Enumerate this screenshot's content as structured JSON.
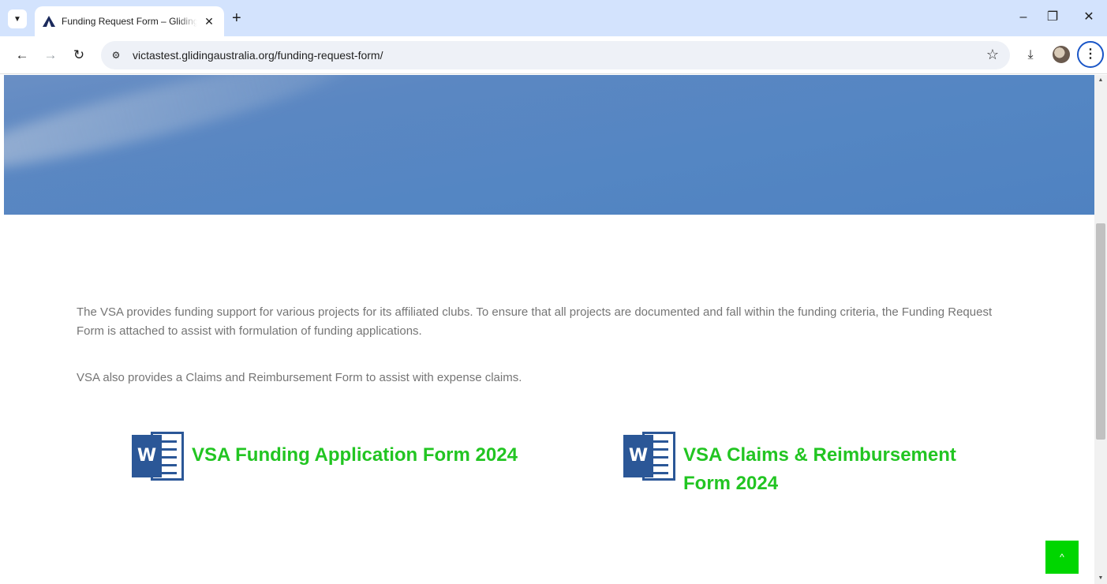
{
  "browser": {
    "tab_title": "Funding Request Form – Gliding Australia",
    "url": "victastest.glidingaustralia.org/funding-request-form/",
    "icons": {
      "tab_search": "chevron-down-icon",
      "favicon": "gliding-australia-logo",
      "tab_close": "close-icon",
      "new_tab": "plus-icon",
      "minimize": "minimize-icon",
      "restore": "restore-icon",
      "close_window": "close-icon",
      "back": "arrow-left-icon",
      "forward": "arrow-right-icon",
      "reload": "reload-icon",
      "site_info": "tune-icon",
      "bookmark": "star-icon",
      "downloads": "download-icon",
      "profile": "avatar",
      "menu": "kebab-menu-icon"
    }
  },
  "page": {
    "intro_text": "The VSA provides funding support for various projects for its affiliated clubs. To ensure that all projects are documented and fall within the funding criteria, the Funding Request Form is attached to assist with formulation of funding applications.",
    "intro_text_2": "VSA also provides a Claims and Reimbursement Form to assist with expense claims.",
    "documents": [
      {
        "label": "VSA Funding Application Form 2024",
        "icon": "word-document-icon",
        "icon_letter": "W"
      },
      {
        "label": "VSA Claims & Reimbursement Form 2024",
        "icon": "word-document-icon",
        "icon_letter": "W"
      }
    ],
    "back_to_top_icon": "chevron-up-icon"
  },
  "colors": {
    "tabbar": "#d3e3fd",
    "link_green": "#22c522",
    "word_blue": "#2b5797",
    "back_to_top": "#00d600",
    "body_text": "#757575"
  }
}
